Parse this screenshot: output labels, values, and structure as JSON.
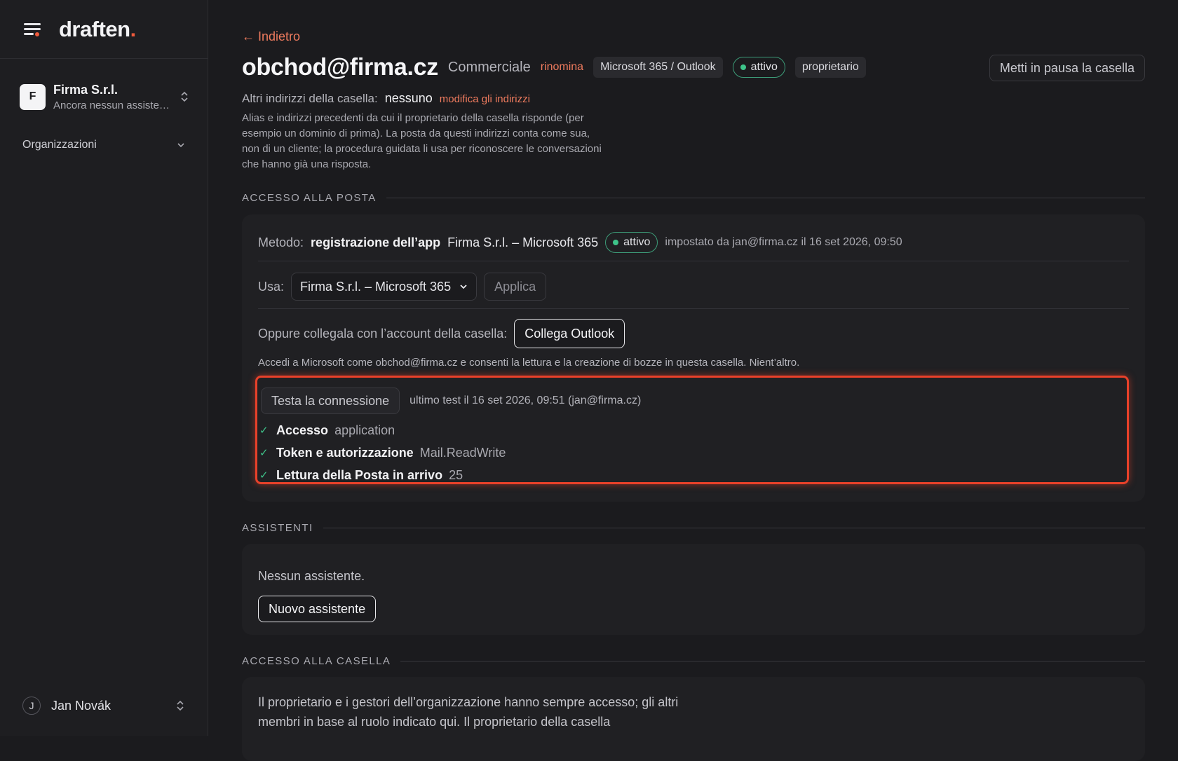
{
  "brand": {
    "name": "draften",
    "dot": "."
  },
  "sidebar": {
    "org": {
      "initial": "F",
      "name": "Firma S.r.l.",
      "subtitle": "Ancora nessun assistente"
    },
    "nav": {
      "organizations": "Organizzazioni"
    },
    "user": {
      "initial": "J",
      "name": "Jan Novák"
    }
  },
  "header": {
    "back": "← Indietro",
    "email": "obchod@firma.cz",
    "role": "Commerciale",
    "rename": "rinomina",
    "provider": "Microsoft 365 / Outlook",
    "status": "attivo",
    "ownership": "proprietario",
    "pause_button": "Metti in pausa la casella"
  },
  "aliases": {
    "label": "Altri indirizzi della casella:",
    "value": "nessuno",
    "edit": "modifica gli indirizzi",
    "help": "Alias e indirizzi precedenti da cui il proprietario della casella risponde (per esempio un dominio di prima). La posta da questi indirizzi conta come sua, non di un cliente; la procedura guidata li usa per riconoscere le conversazioni che hanno già una risposta."
  },
  "mail_access": {
    "section_title": "ACCESSO ALLA POSTA",
    "method_label": "Metodo:",
    "method_app": "registrazione dell’app",
    "method_name": "Firma S.r.l. – Microsoft 365",
    "method_status": "attivo",
    "method_set_by": "impostato da jan@firma.cz il 16 set 2026, 09:50",
    "use_label": "Usa:",
    "use_selected": "Firma S.r.l. – Microsoft 365",
    "apply": "Applica",
    "connect_label": "Oppure collegala con l’account della casella:",
    "connect_button": "Collega Outlook",
    "connect_help": "Accedi a Microsoft come obchod@firma.cz e consenti la lettura e la creazione di bozze in questa casella. Nient’altro.",
    "test": {
      "button": "Testa la connessione",
      "last": "ultimo test il 16 set 2026, 09:51 (jan@firma.cz)",
      "checks": [
        {
          "name": "Accesso",
          "value": "application"
        },
        {
          "name": "Token e autorizzazione",
          "value": "Mail.ReadWrite"
        },
        {
          "name": "Lettura della Posta in arrivo",
          "value": "25"
        }
      ]
    }
  },
  "assistants": {
    "section_title": "ASSISTENTI",
    "empty": "Nessun assistente.",
    "new_button": "Nuovo assistente"
  },
  "mailbox_access": {
    "section_title": "ACCESSO ALLA CASELLA",
    "text": "Il proprietario e i gestori dell’organizzazione hanno sempre accesso; gli altri membri in base al ruolo indicato qui. Il proprietario della casella"
  },
  "colors": {
    "accent": "#ef7b5e",
    "status": "#3ec48a",
    "highlight": "#e8412a"
  }
}
